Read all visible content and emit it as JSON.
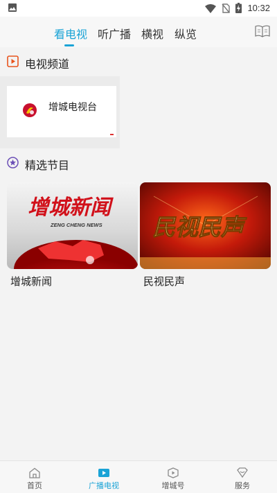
{
  "status_bar": {
    "time": "10:32"
  },
  "top_tabs": [
    {
      "label": "看电视",
      "active": true
    },
    {
      "label": "听广播",
      "active": false
    },
    {
      "label": "横视",
      "active": false
    },
    {
      "label": "纵览",
      "active": false
    }
  ],
  "sections": {
    "tv_channels": {
      "title": "电视频道",
      "icon": "play-icon"
    },
    "featured": {
      "title": "精选节目",
      "icon": "star-icon"
    }
  },
  "channels": [
    {
      "name": "增城电视台",
      "logo": "zengcheng-tv-logo"
    }
  ],
  "programs": [
    {
      "title": "增城新闻",
      "thumb_text": "增城新闻",
      "thumb_subtext": "ZENG CHENG NEWS"
    },
    {
      "title": "民视民声",
      "thumb_text": "民视民声"
    }
  ],
  "bottom_nav": [
    {
      "label": "首页",
      "icon": "home-icon",
      "active": false
    },
    {
      "label": "广播电视",
      "icon": "tv-icon",
      "active": true
    },
    {
      "label": "增城号",
      "icon": "play-circle-icon",
      "active": false
    },
    {
      "label": "服务",
      "icon": "heart-icon",
      "active": false
    }
  ],
  "colors": {
    "accent": "#1aa3d6",
    "section_bg": "#f3f3f3"
  }
}
